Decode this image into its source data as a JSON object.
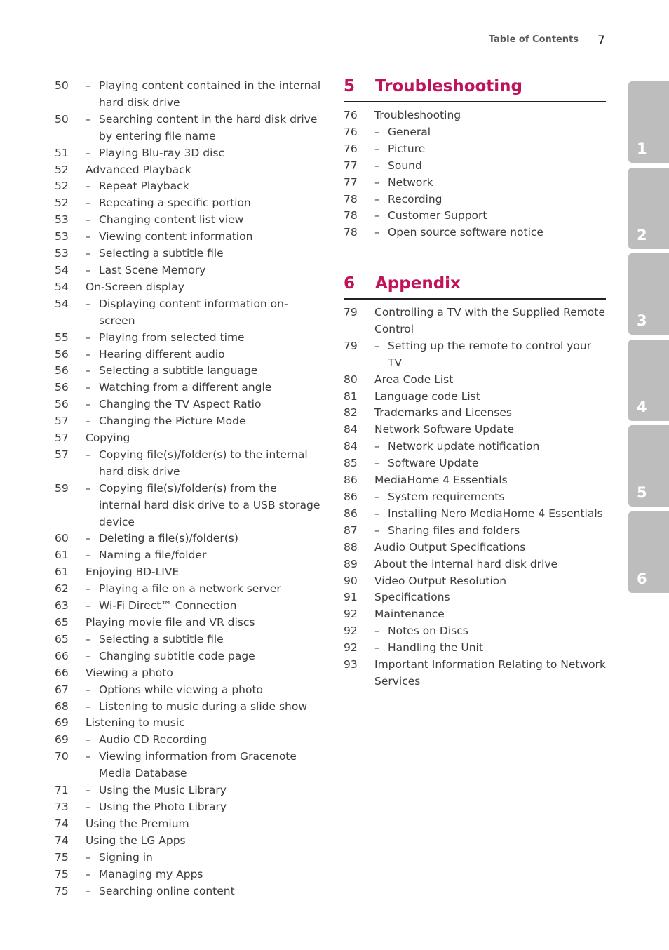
{
  "header": {
    "label": "Table of Contents",
    "page_number": "7"
  },
  "left_entries": [
    {
      "page": "50",
      "text": "Playing content contained in the internal hard disk drive",
      "sub": true
    },
    {
      "page": "50",
      "text": "Searching content in the hard disk drive by entering file name",
      "sub": true
    },
    {
      "page": "51",
      "text": "Playing Blu-ray 3D disc",
      "sub": true
    },
    {
      "page": "52",
      "text": "Advanced Playback",
      "sub": false
    },
    {
      "page": "52",
      "text": "Repeat Playback",
      "sub": true
    },
    {
      "page": "52",
      "text": "Repeating a specific portion",
      "sub": true
    },
    {
      "page": "53",
      "text": "Changing content list view",
      "sub": true
    },
    {
      "page": "53",
      "text": "Viewing content information",
      "sub": true
    },
    {
      "page": "53",
      "text": "Selecting a subtitle file",
      "sub": true
    },
    {
      "page": "54",
      "text": "Last Scene Memory",
      "sub": true
    },
    {
      "page": "54",
      "text": "On-Screen display",
      "sub": false
    },
    {
      "page": "54",
      "text": "Displaying content information on-screen",
      "sub": true
    },
    {
      "page": "55",
      "text": "Playing from selected time",
      "sub": true
    },
    {
      "page": "56",
      "text": "Hearing different audio",
      "sub": true
    },
    {
      "page": "56",
      "text": "Selecting a subtitle language",
      "sub": true
    },
    {
      "page": "56",
      "text": "Watching from a different angle",
      "sub": true
    },
    {
      "page": "56",
      "text": "Changing the TV Aspect Ratio",
      "sub": true
    },
    {
      "page": "57",
      "text": "Changing the Picture Mode",
      "sub": true
    },
    {
      "page": "57",
      "text": "Copying",
      "sub": false
    },
    {
      "page": "57",
      "text": "Copying file(s)/folder(s) to the internal hard disk drive",
      "sub": true
    },
    {
      "page": "59",
      "text": "Copying file(s)/folder(s) from the internal hard disk drive to a USB storage device",
      "sub": true
    },
    {
      "page": "60",
      "text": "Deleting a file(s)/folder(s)",
      "sub": true
    },
    {
      "page": "61",
      "text": "Naming a file/folder",
      "sub": true
    },
    {
      "page": "61",
      "text": "Enjoying BD-LIVE",
      "sub": false
    },
    {
      "page": "62",
      "text": "Playing a file on a network server",
      "sub": true
    },
    {
      "page": "63",
      "text": "Wi-Fi Direct™ Connection",
      "sub": true
    },
    {
      "page": "65",
      "text": "Playing movie file and VR discs",
      "sub": false
    },
    {
      "page": "65",
      "text": "Selecting a subtitle file",
      "sub": true
    },
    {
      "page": "66",
      "text": "Changing subtitle code page",
      "sub": true
    },
    {
      "page": "66",
      "text": "Viewing a photo",
      "sub": false
    },
    {
      "page": "67",
      "text": "Options while viewing a photo",
      "sub": true
    },
    {
      "page": "68",
      "text": "Listening to music during a slide show",
      "sub": true
    },
    {
      "page": "69",
      "text": "Listening to music",
      "sub": false
    },
    {
      "page": "69",
      "text": "Audio CD Recording",
      "sub": true
    },
    {
      "page": "70",
      "text": "Viewing information from Gracenote Media Database",
      "sub": true
    },
    {
      "page": "71",
      "text": "Using the Music Library",
      "sub": true
    },
    {
      "page": "73",
      "text": "Using the Photo Library",
      "sub": true
    },
    {
      "page": "74",
      "text": "Using the Premium",
      "sub": false
    },
    {
      "page": "74",
      "text": "Using the LG Apps",
      "sub": false
    },
    {
      "page": "75",
      "text": "Signing in",
      "sub": true
    },
    {
      "page": "75",
      "text": "Managing my Apps",
      "sub": true
    },
    {
      "page": "75",
      "text": "Searching online content",
      "sub": true
    }
  ],
  "section5": {
    "number": "5",
    "title": "Troubleshooting",
    "entries": [
      {
        "page": "76",
        "text": "Troubleshooting",
        "sub": false
      },
      {
        "page": "76",
        "text": "General",
        "sub": true
      },
      {
        "page": "76",
        "text": "Picture",
        "sub": true
      },
      {
        "page": "77",
        "text": "Sound",
        "sub": true
      },
      {
        "page": "77",
        "text": "Network",
        "sub": true
      },
      {
        "page": "78",
        "text": "Recording",
        "sub": true
      },
      {
        "page": "78",
        "text": "Customer Support",
        "sub": true
      },
      {
        "page": "78",
        "text": "Open source software notice",
        "sub": true
      }
    ]
  },
  "section6": {
    "number": "6",
    "title": "Appendix",
    "entries": [
      {
        "page": "79",
        "text": "Controlling a TV with the Supplied Remote Control",
        "sub": false
      },
      {
        "page": "79",
        "text": "Setting up the remote to control your TV",
        "sub": true
      },
      {
        "page": "80",
        "text": "Area Code List",
        "sub": false
      },
      {
        "page": "81",
        "text": "Language code List",
        "sub": false
      },
      {
        "page": "82",
        "text": "Trademarks and Licenses",
        "sub": false
      },
      {
        "page": "84",
        "text": "Network Software Update",
        "sub": false
      },
      {
        "page": "84",
        "text": "Network update notification",
        "sub": true
      },
      {
        "page": "85",
        "text": "Software Update",
        "sub": true
      },
      {
        "page": "86",
        "text": "MediaHome 4 Essentials",
        "sub": false
      },
      {
        "page": "86",
        "text": "System requirements",
        "sub": true
      },
      {
        "page": "86",
        "text": "Installing Nero MediaHome 4 Essentials",
        "sub": true
      },
      {
        "page": "87",
        "text": "Sharing files and folders",
        "sub": true
      },
      {
        "page": "88",
        "text": "Audio Output Specifications",
        "sub": false
      },
      {
        "page": "89",
        "text": "About the internal hard disk drive",
        "sub": false
      },
      {
        "page": "90",
        "text": "Video Output Resolution",
        "sub": false
      },
      {
        "page": "91",
        "text": "Specifications",
        "sub": false
      },
      {
        "page": "92",
        "text": "Maintenance",
        "sub": false
      },
      {
        "page": "92",
        "text": "Notes on Discs",
        "sub": true
      },
      {
        "page": "92",
        "text": "Handling the Unit",
        "sub": true
      },
      {
        "page": "93",
        "text": "Important Information Relating to Network Services",
        "sub": false
      }
    ]
  },
  "chapter_tabs": [
    "1",
    "2",
    "3",
    "4",
    "5",
    "6"
  ],
  "colors": {
    "accent": "#c0145a",
    "tab": "#bdbdbd"
  }
}
